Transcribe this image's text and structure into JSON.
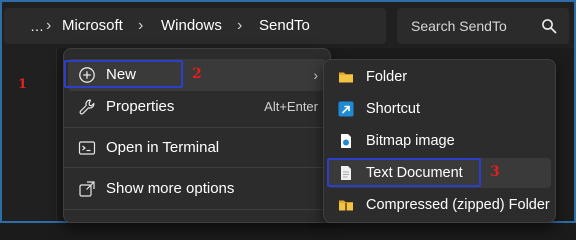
{
  "address_bar": {
    "overflow": "…",
    "crumbs": [
      "Microsoft",
      "Windows",
      "SendTo"
    ],
    "separator": "›"
  },
  "search": {
    "placeholder": "Search SendTo"
  },
  "markers": [
    "1",
    "2",
    "3"
  ],
  "context_menu": {
    "items": [
      {
        "label": "New",
        "icon": "plus-circle-icon",
        "has_submenu": true,
        "arrow": "›"
      },
      {
        "label": "Properties",
        "icon": "wrench-icon",
        "shortcut": "Alt+Enter"
      },
      {
        "label": "Open in Terminal",
        "icon": "terminal-icon"
      },
      {
        "label": "Show more options",
        "icon": "share-icon"
      }
    ]
  },
  "new_submenu": {
    "items": [
      {
        "label": "Folder",
        "icon": "folder-icon"
      },
      {
        "label": "Shortcut",
        "icon": "shortcut-icon"
      },
      {
        "label": "Bitmap image",
        "icon": "bitmap-file-icon"
      },
      {
        "label": "Text Document",
        "icon": "text-file-icon"
      },
      {
        "label": "Compressed (zipped) Folder",
        "icon": "zip-folder-icon"
      }
    ]
  },
  "colors": {
    "annotation_box": "#2b3fc9",
    "annotation_number": "#e0201f",
    "menu_bg": "#2c2c2c",
    "folder": "#f2c443"
  }
}
